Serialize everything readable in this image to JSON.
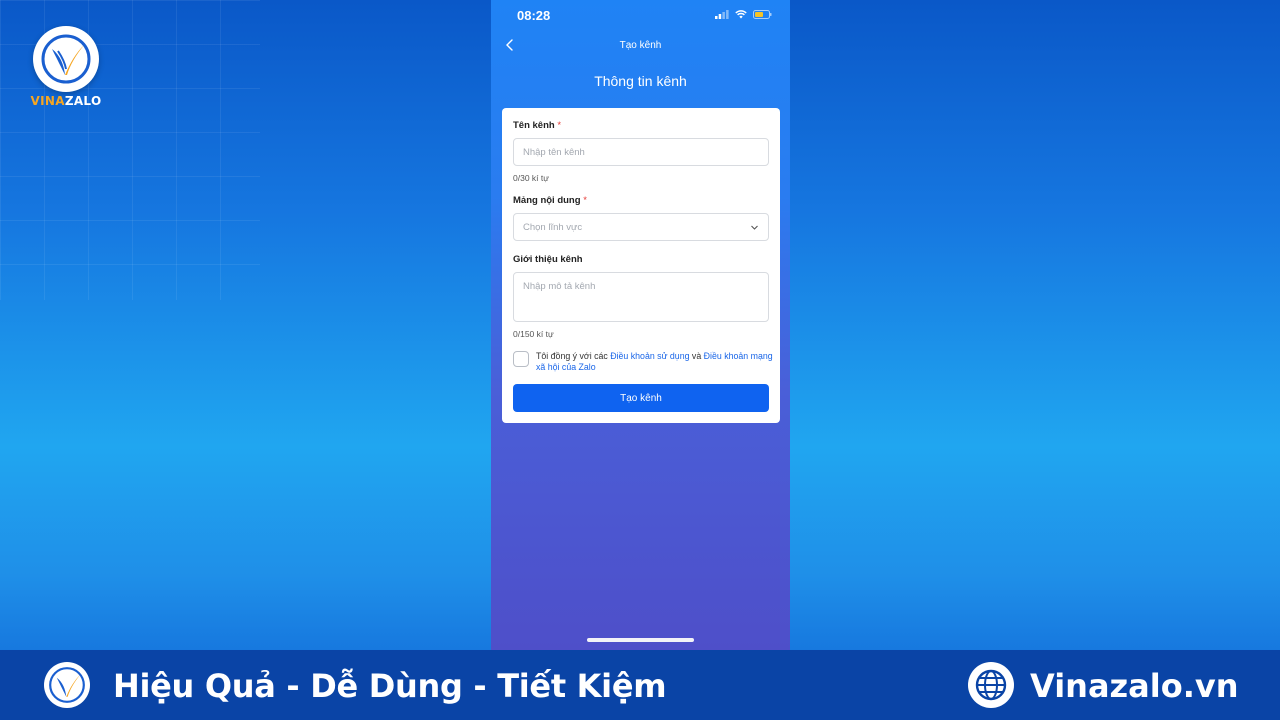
{
  "brand": {
    "name_part1": "VINA",
    "name_part2": "ZALO",
    "accent": "#f5a623"
  },
  "status_bar": {
    "time": "08:28"
  },
  "nav": {
    "title": "Tạo kênh"
  },
  "page": {
    "heading": "Thông tin kênh"
  },
  "form": {
    "channel_name": {
      "label": "Tên kênh",
      "required_mark": "*",
      "placeholder": "Nhập tên kênh",
      "value": "",
      "counter": "0/30 kí tự"
    },
    "content_area": {
      "label": "Mảng nội dung",
      "required_mark": "*",
      "placeholder": "Chọn lĩnh vực"
    },
    "description": {
      "label": "Giới thiệu kênh",
      "placeholder": "Nhập mô tả kênh",
      "value": "",
      "counter": "0/150 kí tự"
    },
    "terms": {
      "checked": false,
      "prefix": "Tôi đồng ý với các ",
      "link1": "Điều khoản sử dụng",
      "middle": " và ",
      "link2": "Điều khoản mạng xã hội của Zalo"
    },
    "submit_label": "Tạo kênh"
  },
  "banner": {
    "slogan": "Hiệu Quả - Dễ Dùng - Tiết Kiệm",
    "website": "Vinazalo.vn"
  },
  "colors": {
    "primary_button": "#0f63f0",
    "link": "#1a66e8",
    "banner_bg": "#0a44a6"
  }
}
